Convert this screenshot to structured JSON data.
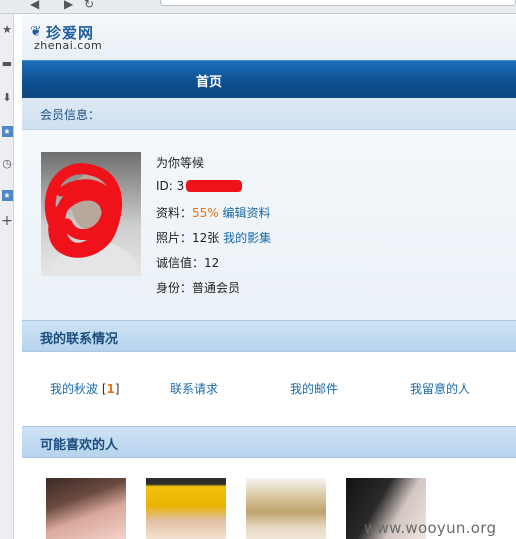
{
  "browser": {
    "sidebar_icons": [
      "star-icon",
      "note-icon",
      "download-icon",
      "bookmark-icon",
      "history-icon",
      "bookmark-icon",
      "add-icon"
    ]
  },
  "site": {
    "logo_cn": "珍爱网",
    "logo_en": "zhenai.com"
  },
  "nav": {
    "home": "首页"
  },
  "member": {
    "header": "会员信息："
  },
  "profile": {
    "nickname": "为你等候",
    "id_label": "ID: 3",
    "profile_label": "资料：",
    "profile_pct": "55%",
    "edit_profile": "编辑资料",
    "photos_label": "照片：12张",
    "my_album": "我的影集",
    "credit": "诚信值：12",
    "identity": "身份：普通会员"
  },
  "contacts": {
    "header": "我的联系情况",
    "wink_label": "我的秋波",
    "wink_open": "[",
    "wink_count": "1",
    "wink_close": "]",
    "requests": "联系请求",
    "mail": "我的邮件",
    "watched": "我留意的人"
  },
  "likes": {
    "header": "可能喜欢的人"
  },
  "watermark": "www.wooyun.org"
}
